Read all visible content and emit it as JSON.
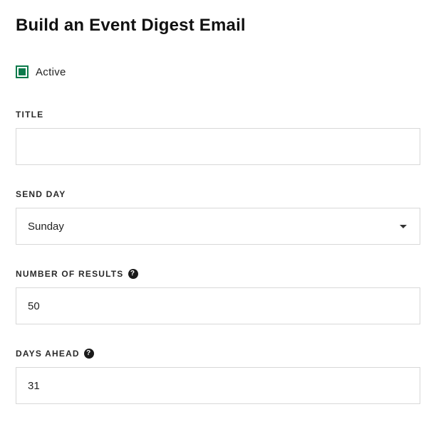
{
  "header": {
    "title": "Build an Event Digest Email"
  },
  "active": {
    "label": "Active",
    "checked": true
  },
  "fields": {
    "title": {
      "label": "TITLE",
      "value": ""
    },
    "send_day": {
      "label": "SEND DAY",
      "value": "Sunday"
    },
    "number_of_results": {
      "label": "NUMBER OF RESULTS",
      "value": "50",
      "help": "?"
    },
    "days_ahead": {
      "label": "DAYS AHEAD",
      "value": "31",
      "help": "?"
    }
  }
}
